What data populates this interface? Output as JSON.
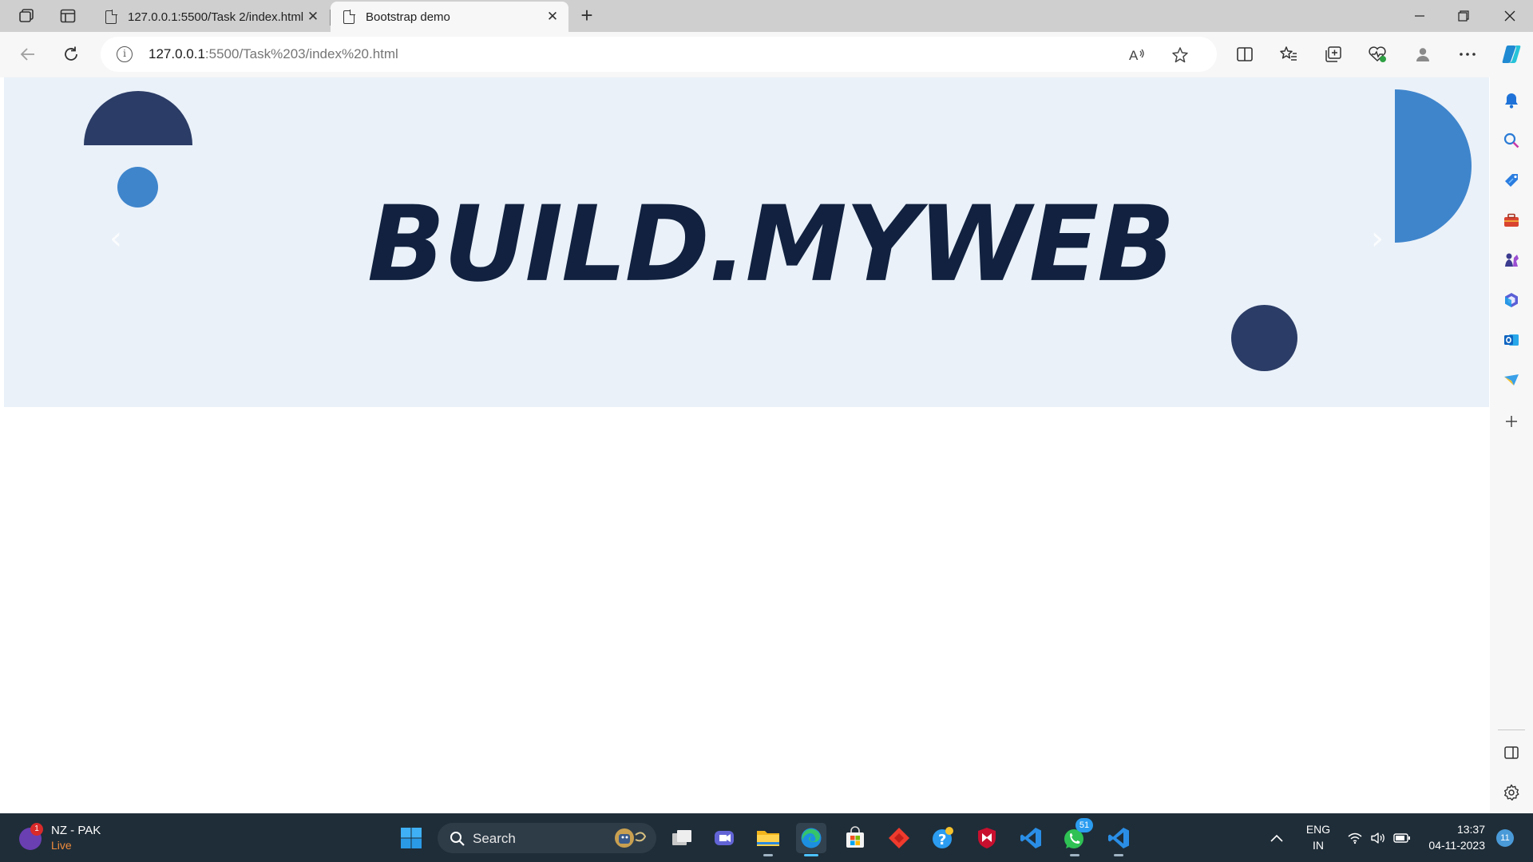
{
  "browser": {
    "tabs": [
      {
        "title": "127.0.0.1:5500/Task 2/index.html"
      },
      {
        "title": "Bootstrap demo"
      }
    ],
    "address": {
      "host": "127.0.0.1",
      "path": ":5500/Task%203/index%20.html"
    }
  },
  "page": {
    "brand": "BUILD.MYWEB",
    "colors": {
      "hero_bg": "#eaf1f9",
      "navy": "#2b3c66",
      "blue": "#3f85cc",
      "brand_text": "#11213f"
    }
  },
  "taskbar": {
    "weather": {
      "title": "NZ - PAK",
      "subtitle": "Live",
      "badge": "1"
    },
    "search_label": "Search",
    "whatsapp_badge": "51",
    "language": {
      "line1": "ENG",
      "line2": "IN"
    },
    "clock": {
      "time": "13:37",
      "date": "04-11-2023"
    },
    "notifications": "11"
  }
}
